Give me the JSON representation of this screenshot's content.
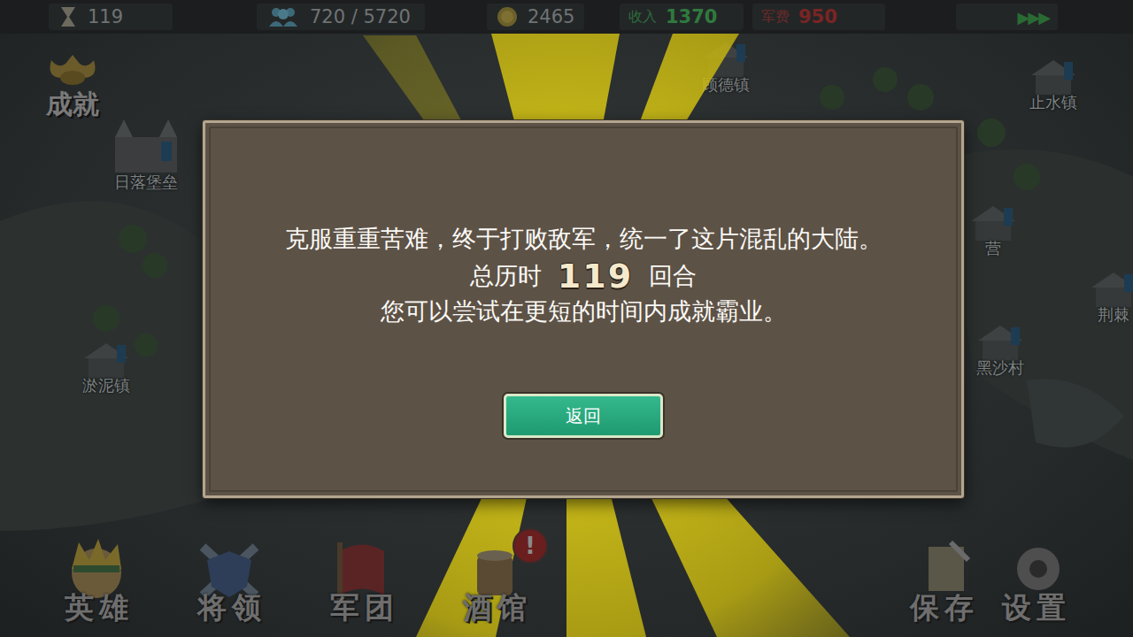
{
  "top_bar": {
    "turns": "119",
    "population": "720 / 5720",
    "gold": "2465",
    "income_label": "收入",
    "income": "1370",
    "expense_label": "军费",
    "expense": "950",
    "speed": "▶▶▶"
  },
  "achievement_button": "成就",
  "map": {
    "locations": [
      {
        "name": "日落堡垒"
      },
      {
        "name": "顾德镇"
      },
      {
        "name": "止水镇"
      },
      {
        "name": "营"
      },
      {
        "name": "荆棘"
      },
      {
        "name": "淤泥镇"
      },
      {
        "name": "黑沙村"
      }
    ]
  },
  "bottom_menu": [
    {
      "label": "英雄",
      "badge": ""
    },
    {
      "label": "将领",
      "badge": ""
    },
    {
      "label": "军团",
      "badge": ""
    },
    {
      "label": "酒馆",
      "badge": "!"
    }
  ],
  "system_menu": [
    {
      "label": "保存"
    },
    {
      "label": "设置"
    }
  ],
  "dialog": {
    "message": "克服重重苦难，终于打败敌军，统一了这片混乱的大陆。",
    "duration_label": "总历时",
    "turns": "119",
    "turns_unit": "回合",
    "hint": "您可以尝试在更短的时间内成就霸业。",
    "button": "返回"
  }
}
